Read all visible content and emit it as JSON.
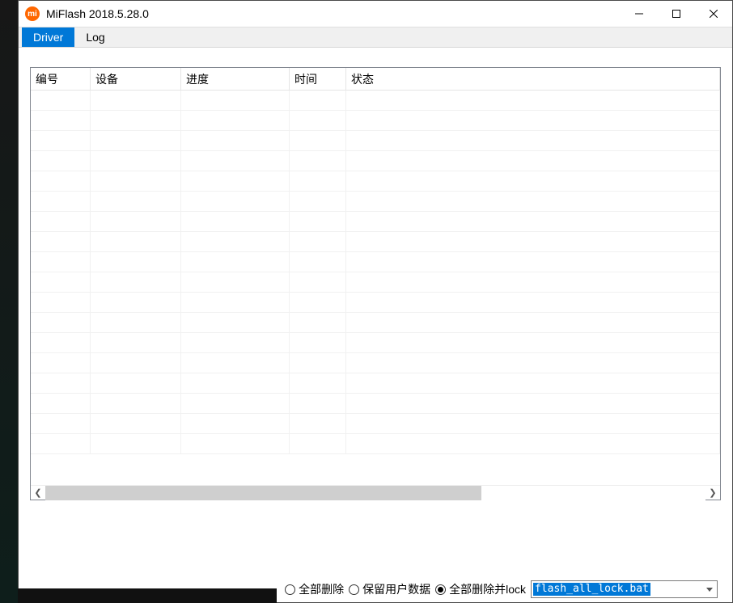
{
  "window": {
    "title": "MiFlash 2018.5.28.0"
  },
  "menubar": {
    "items": [
      "Driver",
      "Log"
    ],
    "active_index": 0
  },
  "grid": {
    "columns": [
      "编号",
      "设备",
      "进度",
      "时间",
      "状态"
    ],
    "rows": []
  },
  "bottom": {
    "radios": [
      {
        "label": "全部删除",
        "checked": false
      },
      {
        "label": "保留用户数据",
        "checked": false
      },
      {
        "label": "全部删除并lock",
        "checked": true
      }
    ],
    "script_value": "flash_all_lock.bat"
  },
  "icons": {
    "app_letter": "mi"
  }
}
